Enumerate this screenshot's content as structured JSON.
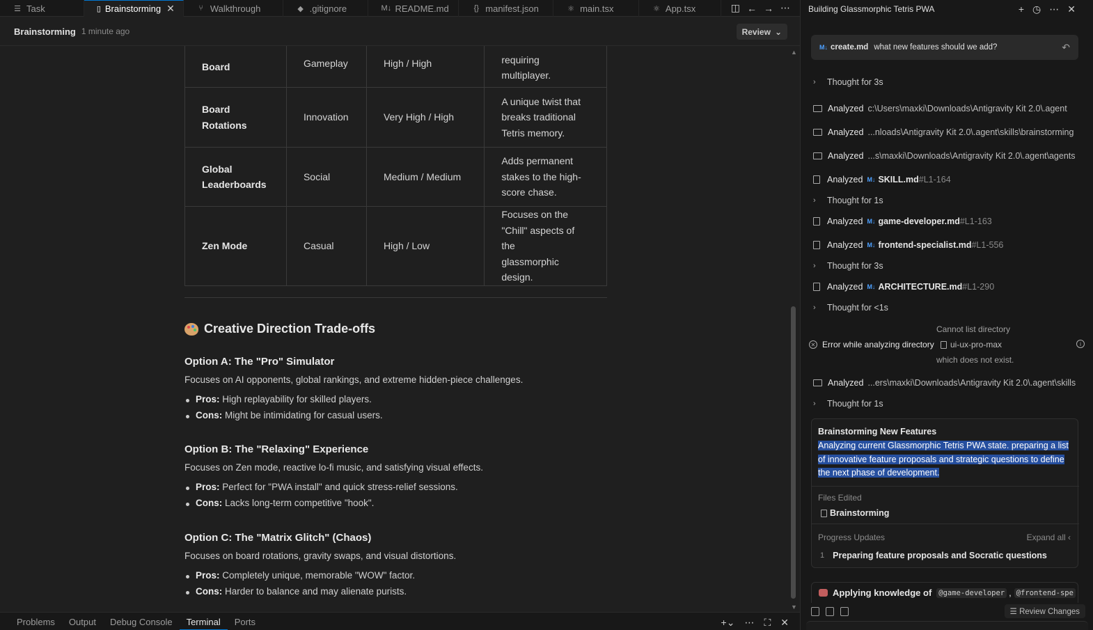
{
  "tabs": [
    {
      "icon": "☰",
      "label": "Task",
      "active": false
    },
    {
      "icon": "▯",
      "label": "Brainstorming",
      "active": true
    },
    {
      "icon": "⑂",
      "label": "Walkthrough",
      "active": false
    },
    {
      "icon": "◆",
      "label": ".gitignore",
      "active": false
    },
    {
      "icon": "M↓",
      "label": "README.md",
      "active": false
    },
    {
      "icon": "{}",
      "label": "manifest.json",
      "active": false
    },
    {
      "icon": "⚛",
      "label": "main.tsx",
      "active": false
    },
    {
      "icon": "⚛",
      "label": "App.tsx",
      "active": false
    }
  ],
  "doc": {
    "title": "Brainstorming",
    "time": "1 minute ago",
    "review": "Review"
  },
  "table": {
    "rows": [
      {
        "c0": [
          "Board"
        ],
        "c1": "Gameplay",
        "c2": "High / High",
        "c3": [
          "requiring",
          "multiplayer."
        ]
      },
      {
        "c0": [
          "Board",
          "Rotations"
        ],
        "c1": "Innovation",
        "c2": "Very High / High",
        "c3": [
          "A unique twist that",
          "breaks traditional",
          "Tetris memory."
        ]
      },
      {
        "c0": [
          "Global",
          "Leaderboards"
        ],
        "c1": "Social",
        "c2": "Medium / Medium",
        "c3": [
          "Adds permanent",
          "stakes to the high-",
          "score chase."
        ]
      },
      {
        "c0": [
          "Zen Mode"
        ],
        "c1": "Casual",
        "c2": "High / Low",
        "c3": [
          "Focuses on the",
          "\"Chill\" aspects of the",
          "glassmorphic",
          "design."
        ]
      }
    ]
  },
  "section": {
    "heading": "Creative Direction Trade-offs",
    "options": [
      {
        "title": "Option A: The \"Pro\" Simulator",
        "desc": "Focuses on AI opponents, global rankings, and extreme hidden-piece challenges.",
        "pros_label": "Pros:",
        "pros": " High replayability for skilled players.",
        "cons_label": "Cons:",
        "cons": " Might be intimidating for casual users."
      },
      {
        "title": "Option B: The \"Relaxing\" Experience",
        "desc": "Focuses on Zen mode, reactive lo-fi music, and satisfying visual effects.",
        "pros_label": "Pros:",
        "pros": " Perfect for \"PWA install\" and quick stress-relief sessions.",
        "cons_label": "Cons:",
        "cons": " Lacks long-term competitive \"hook\"."
      },
      {
        "title": "Option C: The \"Matrix Glitch\" (Chaos)",
        "desc": "Focuses on board rotations, gravity swaps, and visual distortions.",
        "pros_label": "Pros:",
        "pros": " Completely unique, memorable \"WOW\" factor.",
        "cons_label": "Cons:",
        "cons": " Harder to balance and may alienate purists."
      }
    ]
  },
  "panel": {
    "tabs": [
      "Problems",
      "Output",
      "Debug Console",
      "Terminal",
      "Ports"
    ],
    "active": "Terminal"
  },
  "agent": {
    "title": "Building Glassmorphic Tetris PWA",
    "query_file": "create.md",
    "query_text": "what new features should we add?",
    "steps": [
      {
        "kind": "thought",
        "label": "Thought for 3s"
      },
      {
        "kind": "folder",
        "label": "Analyzed",
        "path": "c:\\Users\\maxki\\Downloads\\Antigravity Kit 2.0\\.agent"
      },
      {
        "kind": "folder",
        "label": "Analyzed",
        "path": "...nloads\\Antigravity Kit 2.0\\.agent\\skills\\brainstorming"
      },
      {
        "kind": "folder",
        "label": "Analyzed",
        "path": "...s\\maxki\\Downloads\\Antigravity Kit 2.0\\.agent\\agents"
      },
      {
        "kind": "file",
        "label": "Analyzed",
        "file": "SKILL.md",
        "range": "#L1-164"
      },
      {
        "kind": "thought",
        "label": "Thought for 1s"
      },
      {
        "kind": "file",
        "label": "Analyzed",
        "file": "game-developer.md",
        "range": "#L1-163"
      },
      {
        "kind": "file",
        "label": "Analyzed",
        "file": "frontend-specialist.md",
        "range": "#L1-556"
      },
      {
        "kind": "thought",
        "label": "Thought for 3s"
      },
      {
        "kind": "file",
        "label": "Analyzed",
        "file": "ARCHITECTURE.md",
        "range": "#L1-290"
      },
      {
        "kind": "thought",
        "label": "Thought for <1s"
      }
    ],
    "error": {
      "line1": "Cannot list directory",
      "label": "Error while analyzing directory",
      "dir": "ui-ux-pro-max",
      "line3": "which does not exist."
    },
    "steps2": [
      {
        "kind": "folder",
        "label": "Analyzed",
        "path": "...ers\\maxki\\Downloads\\Antigravity Kit 2.0\\.agent\\skills"
      },
      {
        "kind": "thought",
        "label": "Thought for 1s"
      }
    ],
    "card": {
      "title": "Brainstorming New Features",
      "summary": "Analyzing current Glassmorphic Tetris PWA state. preparing a list of innovative feature proposals and strategic questions to define the next phase of development.",
      "files_label": "Files Edited",
      "file": "Brainstorming",
      "progress_label": "Progress Updates",
      "expand_all": "Expand all",
      "progress_num": "1",
      "progress_text": "Preparing feature proposals and Socratic questions"
    },
    "apply": {
      "label": "Applying knowledge of",
      "tag1": "@game-developer",
      "tag2": "@frontend-spe"
    },
    "review_changes": "Review Changes"
  }
}
